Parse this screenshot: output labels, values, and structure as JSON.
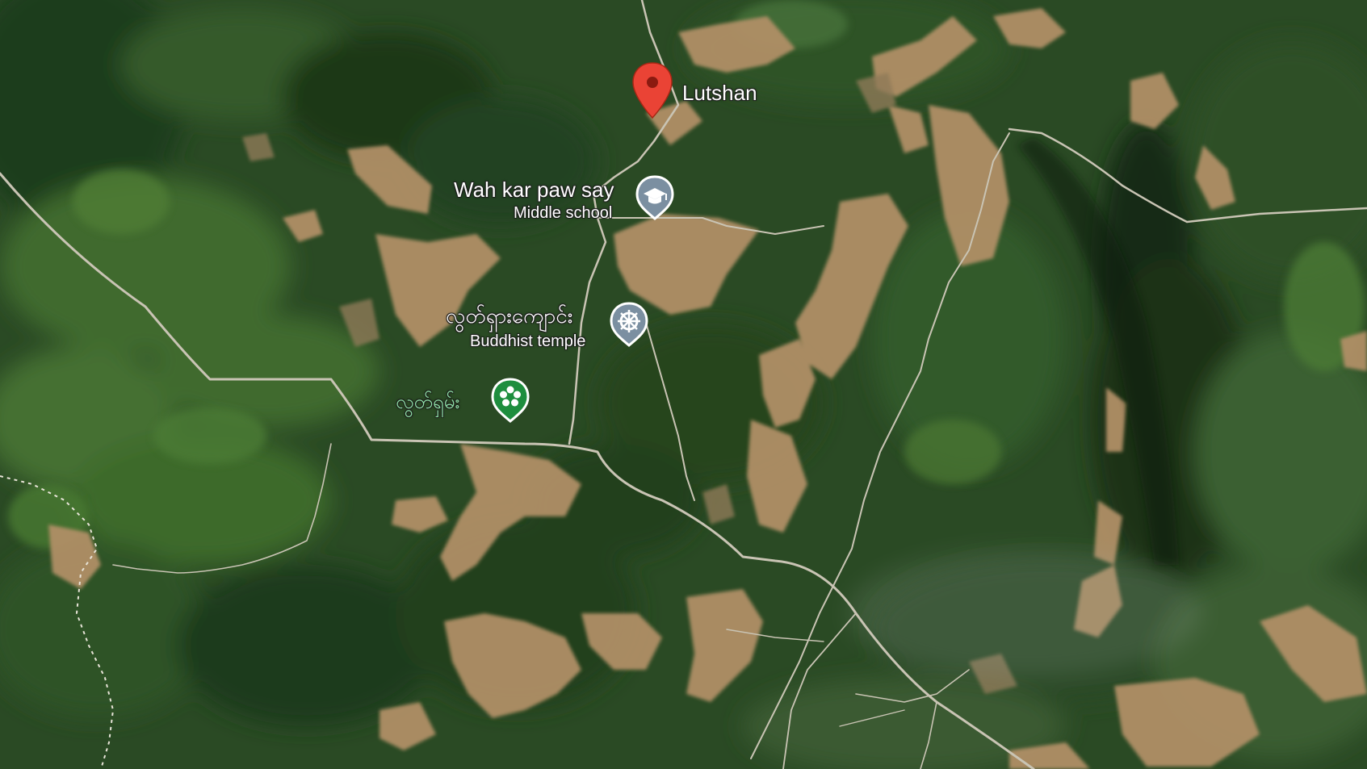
{
  "map": {
    "type": "satellite",
    "places": [
      {
        "key": "lutshan",
        "name": "Lutshan",
        "icon": "red-location-pin-icon",
        "color": "#ea4335"
      },
      {
        "key": "school",
        "name": "Wah kar paw say",
        "category": "Middle school",
        "icon": "graduation-cap-icon",
        "color": "#7b8fa1"
      },
      {
        "key": "temple",
        "name": "လွတ်ရှားကျောင်း",
        "category": "Buddhist temple",
        "icon": "dharma-wheel-icon",
        "color": "#7b8fa1"
      },
      {
        "key": "park",
        "name": "လွတ်ရှမ်း",
        "icon": "flower-icon",
        "color": "#1e8e3e"
      }
    ]
  }
}
